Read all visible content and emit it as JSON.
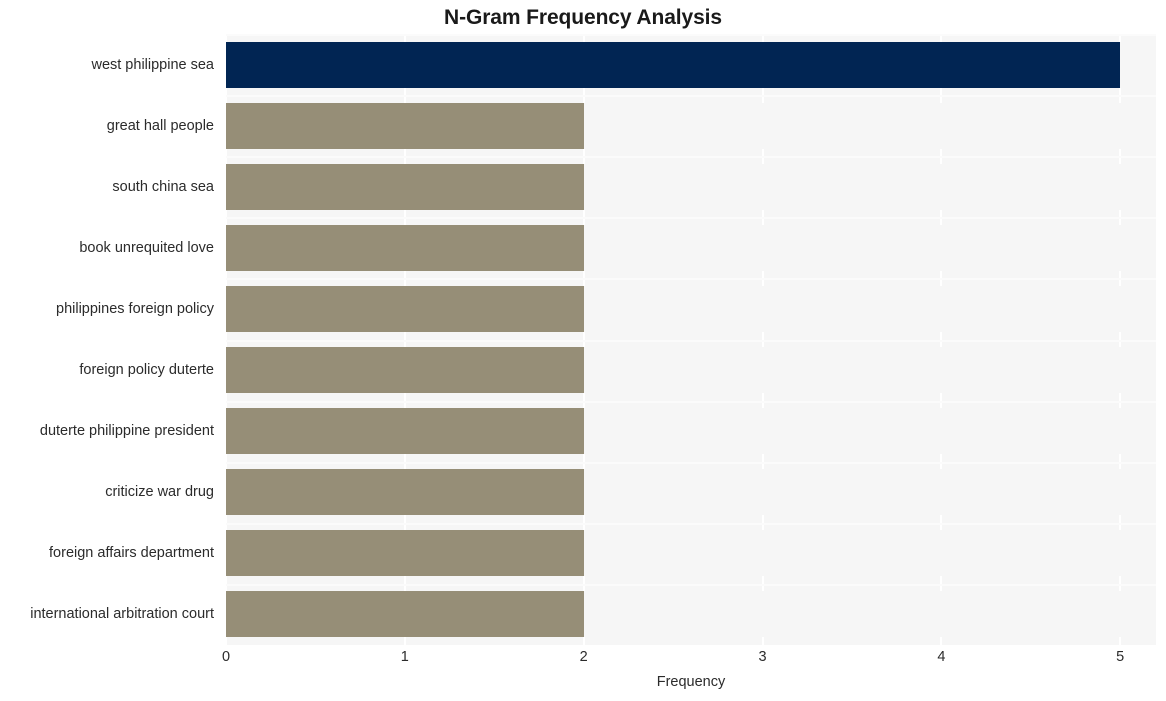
{
  "chart_data": {
    "type": "bar",
    "orientation": "horizontal",
    "title": "N-Gram Frequency Analysis",
    "xlabel": "Frequency",
    "ylabel": "",
    "xlim": [
      0,
      5.2
    ],
    "xticks": [
      "0",
      "1",
      "2",
      "3",
      "4",
      "5"
    ],
    "xtick_values": [
      0,
      1,
      2,
      3,
      4,
      5
    ],
    "grid": "vertical",
    "legend": "none",
    "categories": [
      "west philippine sea",
      "great hall people",
      "south china sea",
      "book unrequited love",
      "philippines foreign policy",
      "foreign policy duterte",
      "duterte philippine president",
      "criticize war drug",
      "foreign affairs department",
      "international arbitration court"
    ],
    "values": [
      5,
      2,
      2,
      2,
      2,
      2,
      2,
      2,
      2,
      2
    ],
    "bar_colors": [
      "#012553",
      "#968e77",
      "#968e77",
      "#968e77",
      "#968e77",
      "#968e77",
      "#968e77",
      "#968e77",
      "#968e77",
      "#968e77"
    ],
    "highlight_color": "#012553",
    "default_color": "#968e77",
    "plot_background": "#f6f6f6",
    "figure_background": "#ffffff",
    "gridline_color": "#ffffff"
  }
}
